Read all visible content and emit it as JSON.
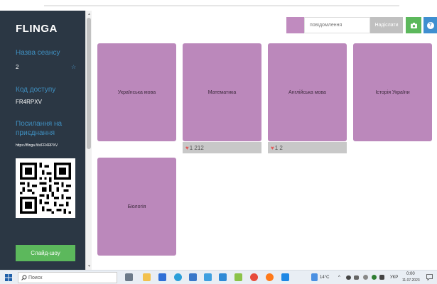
{
  "app": {
    "logo": "FLINGA"
  },
  "sidebar": {
    "session_name_label": "Назва сеансу",
    "session_name_value": "2",
    "access_code_label": "Код доступу",
    "access_code_value": "FR4RPXV",
    "invite_link_label": "Посилання на приєднання",
    "invite_link_value": "https://flinga.fi/s/FR4RPXV",
    "slideshow_label": "Слайд-шоу"
  },
  "topbar": {
    "message_placeholder": "повідомлення",
    "send_label": "Надіслати",
    "help_label": "?",
    "swatch_color": "#c08bbf"
  },
  "cards": [
    {
      "title": "Українська мова",
      "likes": ""
    },
    {
      "title": "Математика",
      "likes": "1 212"
    },
    {
      "title": "Англійська мова",
      "likes": "1 2"
    },
    {
      "title": "Історія України",
      "likes": ""
    },
    {
      "title": "Біологія",
      "likes": ""
    }
  ],
  "colors": {
    "sidebar_bg": "#2b3744",
    "card_bg": "#bb88bb",
    "accent_green": "#5cb85c",
    "label_blue": "#3f8fc0"
  },
  "taskbar": {
    "search_placeholder": "Поиск",
    "temperature": "14°C",
    "language": "УКР",
    "time": "0:00",
    "date": "11.07.2023"
  }
}
